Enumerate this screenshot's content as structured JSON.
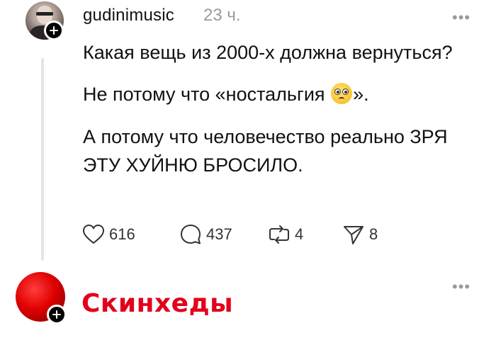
{
  "post": {
    "username": "gudinimusic",
    "time": "23 ч.",
    "more": "•••",
    "paragraph1": "Какая вещь из 2000-х должна вернуться?",
    "paragraph2_before": "Не потому что «ностальгия ",
    "paragraph2_after": "».",
    "paragraph3": "А потому что человечество реально ЗРЯ ЭТУ ХУЙНЮ БРОСИЛО.",
    "emoji_icon": "pleading-face-emoji",
    "stats": {
      "likes": "616",
      "comments": "437",
      "reposts": "4",
      "shares": "8"
    }
  },
  "next_post": {
    "title": "Скинхеды",
    "more": "•••",
    "title_color": "#e3001b"
  }
}
